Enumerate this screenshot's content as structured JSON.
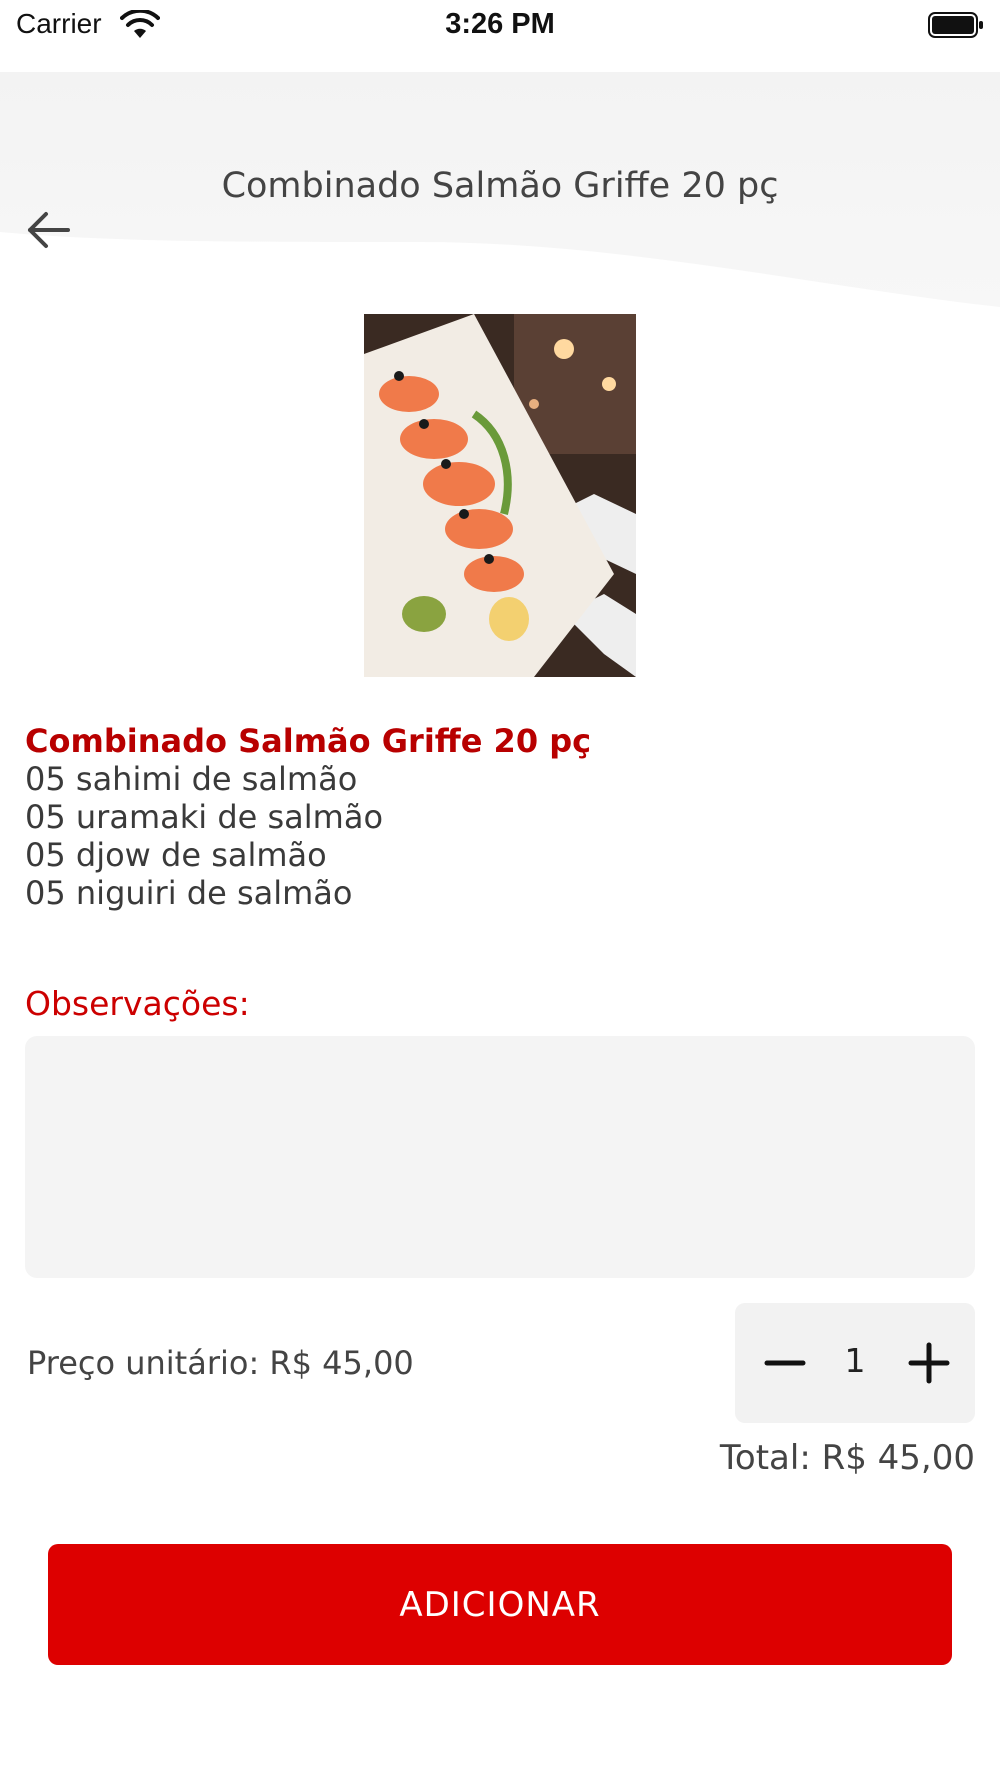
{
  "status_bar": {
    "carrier": "Carrier",
    "time": "3:26 PM"
  },
  "header": {
    "title": "Combinado Salmão Griffe 20 pç",
    "back_icon": "arrow-left-icon"
  },
  "product": {
    "image_icon": "sushi-platter-photo",
    "name": "Combinado Salmão Griffe 20 pç",
    "items": [
      "05 sahimi de salmão",
      "05 uramaki de salmão",
      "05 djow de salmão",
      "05 niguiri de salmão"
    ]
  },
  "observations": {
    "label": "Observações:",
    "value": "",
    "placeholder": ""
  },
  "pricing": {
    "unit_price": "Preço unitário: R$ 45,00",
    "quantity": "1",
    "total": "Total: R$ 45,00"
  },
  "actions": {
    "add_label": "ADICIONAR"
  },
  "colors": {
    "accent": "#dd0000",
    "title_red": "#b80000",
    "field_bg": "#f4f4f4"
  }
}
